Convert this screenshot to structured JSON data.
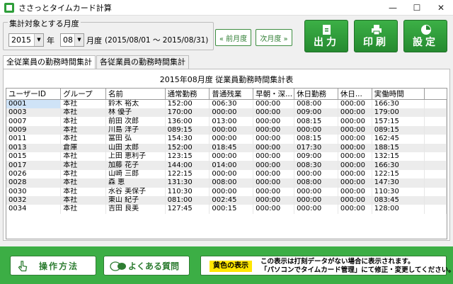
{
  "window": {
    "title": "ささっとタイムカード計算",
    "minimize": "—",
    "maximize": "☐",
    "close": "✕"
  },
  "period": {
    "legend": "集計対象とする月度",
    "year": "2015",
    "year_suffix": "年",
    "month": "08",
    "month_suffix": "月度",
    "range_text": "(2015/08/01 〜 2015/08/31)",
    "prev_label": "« 前月度",
    "next_label": "次月度 »"
  },
  "toolbar": {
    "output_label": "出力",
    "print_label": "印刷",
    "settings_label": "設定"
  },
  "tabs": [
    {
      "label": "全従業員の勤務時間集計",
      "active": true
    },
    {
      "label": "各従業員の勤務時間集計",
      "active": false
    }
  ],
  "report": {
    "title": "2015年08月度 従業員勤務時間集計表",
    "columns": [
      "ユーザーID",
      "グループ",
      "名前",
      "通常勤務",
      "普通残業",
      "早朝・深...",
      "休日勤務",
      "休日...",
      "実働時間"
    ],
    "rows": [
      [
        "0001",
        "本社",
        "鈴木 裕太",
        "152:00",
        "006:30",
        "000:00",
        "008:00",
        "000:00",
        "166:30"
      ],
      [
        "0003",
        "本社",
        "林 優子",
        "170:00",
        "000:00",
        "000:00",
        "009:00",
        "000:00",
        "179:00"
      ],
      [
        "0007",
        "本社",
        "前田 次郎",
        "136:00",
        "013:00",
        "000:00",
        "008:15",
        "000:00",
        "157:15"
      ],
      [
        "0009",
        "本社",
        "川島 洋子",
        "089:15",
        "000:00",
        "000:00",
        "000:00",
        "000:00",
        "089:15"
      ],
      [
        "0011",
        "本社",
        "富田 弘",
        "154:30",
        "000:00",
        "000:00",
        "008:15",
        "000:00",
        "162:45"
      ],
      [
        "0013",
        "倉庫",
        "山田 太郎",
        "152:00",
        "018:45",
        "000:00",
        "017:30",
        "000:00",
        "188:15"
      ],
      [
        "0015",
        "本社",
        "上田 恵利子",
        "123:15",
        "000:00",
        "000:00",
        "009:00",
        "000:00",
        "132:15"
      ],
      [
        "0017",
        "本社",
        "加藤 花子",
        "144:00",
        "014:00",
        "000:00",
        "008:30",
        "000:00",
        "166:30"
      ],
      [
        "0026",
        "本社",
        "山崎 三郎",
        "122:15",
        "000:00",
        "000:00",
        "000:00",
        "000:00",
        "122:15"
      ],
      [
        "0028",
        "本社",
        "森 恵",
        "131:30",
        "008:00",
        "000:00",
        "008:00",
        "000:00",
        "147:30"
      ],
      [
        "0030",
        "本社",
        "水谷 美保子",
        "110:30",
        "000:00",
        "000:00",
        "000:00",
        "000:00",
        "110:30"
      ],
      [
        "0032",
        "本社",
        "東山 紀子",
        "081:00",
        "002:45",
        "000:00",
        "000:00",
        "000:00",
        "083:45"
      ],
      [
        "0034",
        "本社",
        "吉田 良美",
        "127:45",
        "000:15",
        "000:00",
        "000:00",
        "000:00",
        "128:00"
      ]
    ]
  },
  "footer": {
    "howto_label": "操作方法",
    "faq_label": "よくある質問",
    "yellow_label": "黄色の表示",
    "info_line1": "この表示は打刻データがない場合に表示されます。",
    "info_line2": "「パソコンでタイムカード管理」にて修正・変更してください。"
  },
  "colors": {
    "brand_green": "#3cae45",
    "highlight_yellow": "#ffe600"
  }
}
